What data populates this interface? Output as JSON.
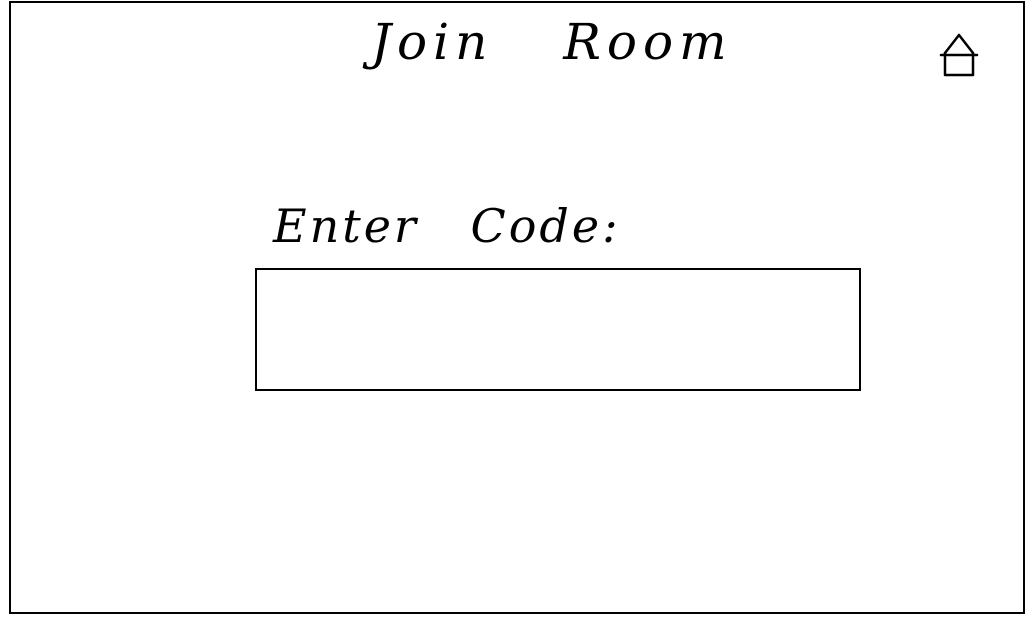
{
  "header": {
    "title": "Join Room",
    "home_icon": "home-icon"
  },
  "form": {
    "label": "Enter Code:",
    "code_input": {
      "value": "",
      "placeholder": ""
    }
  },
  "colors": {
    "stroke": "#000000",
    "background": "#ffffff"
  }
}
